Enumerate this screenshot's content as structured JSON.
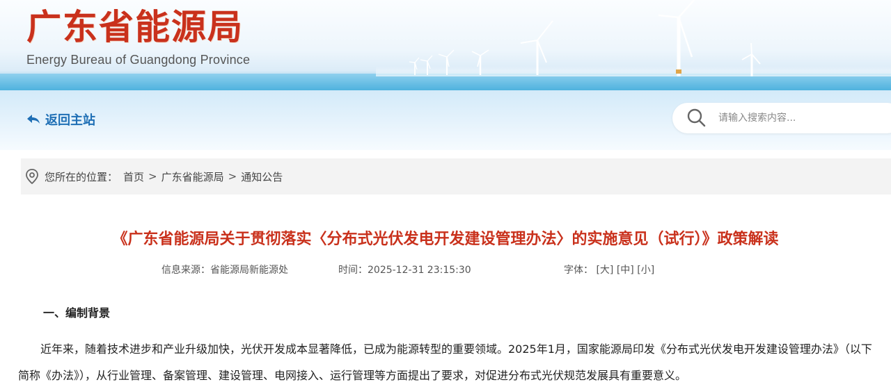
{
  "header": {
    "title_cn": "广东省能源局",
    "title_en": "Energy Bureau of Guangdong Province"
  },
  "nav": {
    "back_label": "返回主站",
    "search_placeholder": "请输入搜索内容..."
  },
  "breadcrumb": {
    "prefix": "您所在的位置：",
    "items": [
      "首页",
      "广东省能源局",
      "通知公告"
    ],
    "separator": ">"
  },
  "article": {
    "title": "《广东省能源局关于贯彻落实〈分布式光伏发电开发建设管理办法〉的实施意见（试行）》政策解读",
    "source_label": "信息来源：",
    "source": "省能源局新能源处",
    "time_label": "时间：",
    "time": "2025-12-31 23:15:30",
    "font_label": "字体：",
    "font_options": [
      "[大]",
      "[中]",
      "[小]"
    ],
    "section_heading": "一、编制背景",
    "paragraph": "近年来，随着技术进步和产业升级加快，光伏开发成本显著降低，已成为能源转型的重要领域。2025年1月，国家能源局印发《分布式光伏发电开发建设管理办法》（以下简称《办法》），从行业管理、备案管理、建设管理、电网接入、运行管理等方面提出了要求，对促进分布式光伏规范发展具有重要意义。"
  },
  "colors": {
    "brand_red": "#c9311c",
    "link_blue": "#1f6fb5",
    "breadcrumb_bg": "#f3f3f3"
  },
  "icons": [
    "wind-turbine-icon",
    "back-arrow-icon",
    "search-icon",
    "location-pin-icon"
  ]
}
